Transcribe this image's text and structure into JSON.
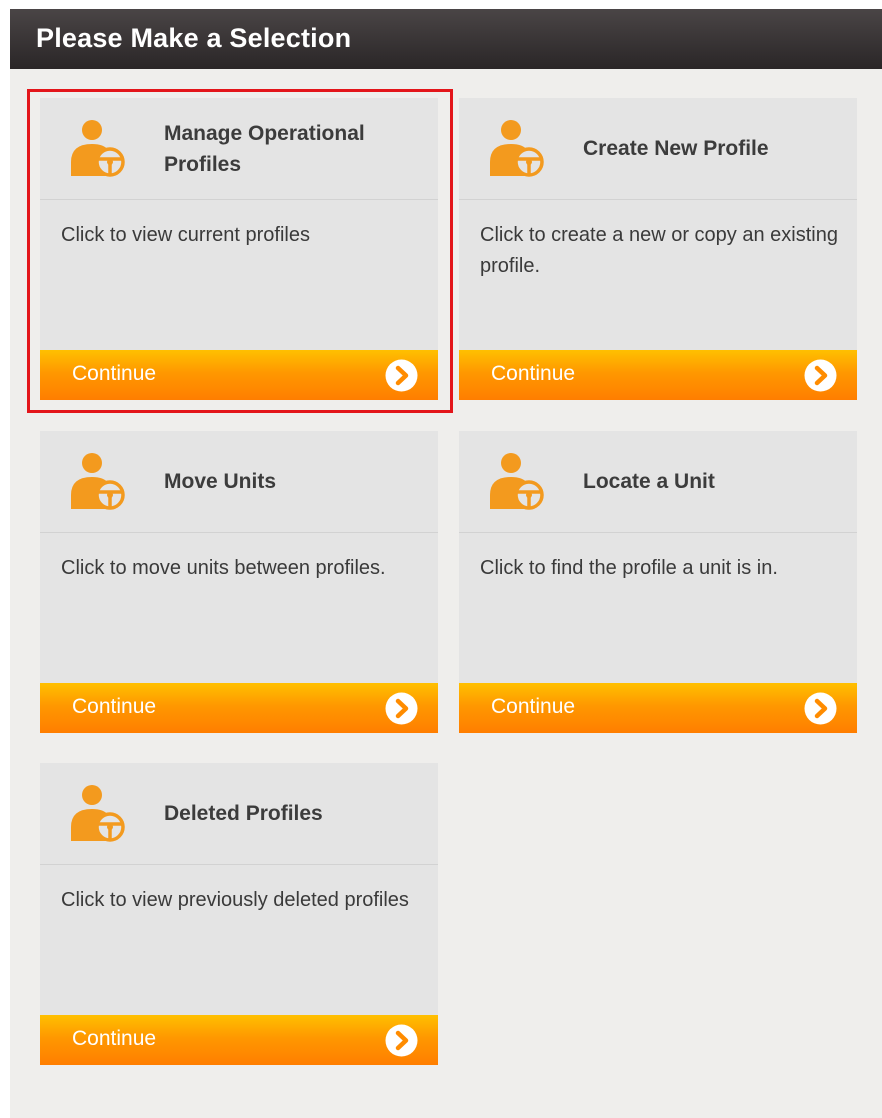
{
  "header": {
    "title": "Please Make a Selection"
  },
  "cards": [
    {
      "title": "Manage Operational Profiles",
      "description": "Click to view current profiles",
      "button_label": "Continue",
      "icon": "user-steering-wheel-icon"
    },
    {
      "title": "Create New Profile",
      "description": "Click to create a new or copy an existing profile.",
      "button_label": "Continue",
      "icon": "user-steering-wheel-icon"
    },
    {
      "title": "Move Units",
      "description": "Click to move units between profiles.",
      "button_label": "Continue",
      "icon": "user-steering-wheel-icon"
    },
    {
      "title": "Locate a Unit",
      "description": "Click to find the profile a unit is in.",
      "button_label": "Continue",
      "icon": "user-steering-wheel-icon"
    },
    {
      "title": "Deleted Profiles",
      "description": "Click to view previously deleted profiles",
      "button_label": "Continue",
      "icon": "user-steering-wheel-icon"
    }
  ],
  "colors": {
    "accent": "#ff9800",
    "highlight": "#e3151a",
    "header": "#2f2b2c"
  }
}
